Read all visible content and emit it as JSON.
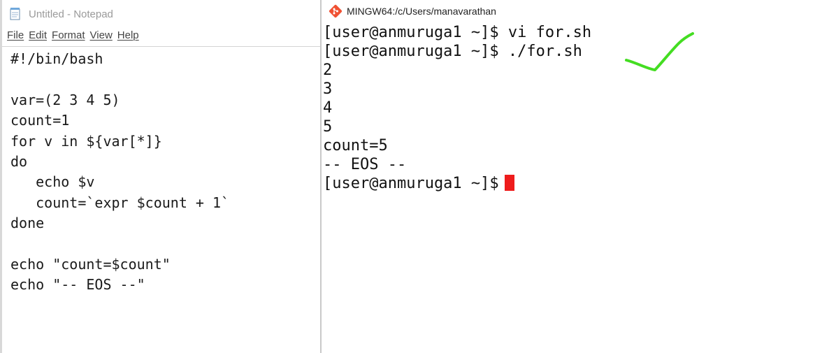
{
  "notepad": {
    "title": "Untitled - Notepad",
    "menu": [
      "File",
      "Edit",
      "Format",
      "View",
      "Help"
    ],
    "content": "#!/bin/bash\n\nvar=(2 3 4 5)\ncount=1\nfor v in ${var[*]}\ndo\n   echo $v\n   count=`expr $count + 1`\ndone\n\necho \"count=$count\"\necho \"-- EOS --\""
  },
  "terminal": {
    "title": "MINGW64:/c/Users/manavarathan",
    "lines": [
      "[user@anmuruga1 ~]$ vi for.sh",
      "[user@anmuruga1 ~]$ ./for.sh",
      "2",
      "3",
      "4",
      "5",
      "count=5",
      "-- EOS --"
    ],
    "prompt": "[user@anmuruga1 ~]$",
    "cursor_color": "#ee1c1c"
  },
  "annotation": {
    "icon": "checkmark-icon",
    "color": "#44dd22"
  }
}
